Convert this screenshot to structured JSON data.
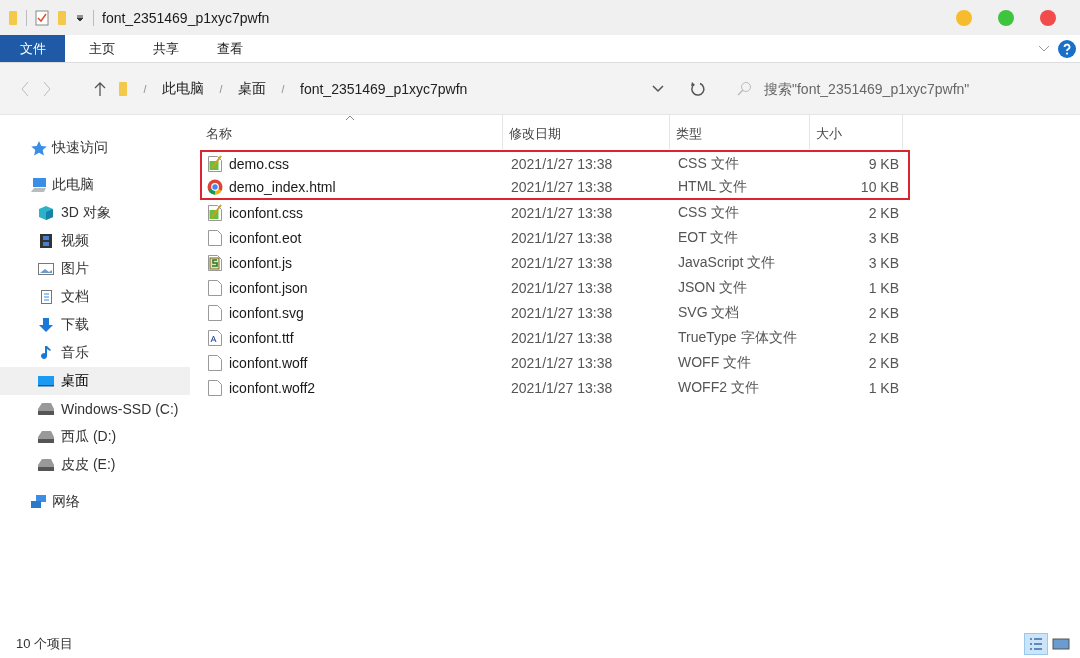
{
  "window": {
    "title": "font_2351469_p1xyc7pwfn"
  },
  "ribbon_tabs": [
    {
      "label": "文件",
      "selected": true
    },
    {
      "label": "主页",
      "selected": false
    },
    {
      "label": "共享",
      "selected": false
    },
    {
      "label": "查看",
      "selected": false
    }
  ],
  "breadcrumb": [
    "此电脑",
    "桌面",
    "font_2351469_p1xyc7pwfn"
  ],
  "search": {
    "placeholder": "搜索\"font_2351469_p1xyc7pwfn\""
  },
  "sidebar": {
    "items": [
      {
        "label": "快速访问",
        "kind": "star",
        "selected": false
      },
      {
        "label": "此电脑",
        "kind": "pc",
        "selected": false,
        "children": [
          {
            "label": "3D 对象",
            "kind": "cube",
            "selected": false
          },
          {
            "label": "视频",
            "kind": "video",
            "selected": false
          },
          {
            "label": "图片",
            "kind": "picture",
            "selected": false
          },
          {
            "label": "文档",
            "kind": "doc",
            "selected": false
          },
          {
            "label": "下载",
            "kind": "download",
            "selected": false
          },
          {
            "label": "音乐",
            "kind": "music",
            "selected": false
          },
          {
            "label": "桌面",
            "kind": "desktop",
            "selected": true
          },
          {
            "label": "Windows-SSD (C:)",
            "kind": "drive",
            "selected": false
          },
          {
            "label": "西瓜 (D:)",
            "kind": "drive",
            "selected": false
          },
          {
            "label": "皮皮 (E:)",
            "kind": "drive",
            "selected": false
          }
        ]
      },
      {
        "label": "网络",
        "kind": "network",
        "selected": false
      }
    ]
  },
  "table": {
    "columns": [
      "名称",
      "修改日期",
      "类型",
      "大小"
    ],
    "rows": [
      {
        "name": "demo.css",
        "kind": "css",
        "date": "2021/1/27 13:38",
        "type": "CSS 文件",
        "size": "9 KB",
        "highlighted": true
      },
      {
        "name": "demo_index.html",
        "kind": "html",
        "date": "2021/1/27 13:38",
        "type": "HTML 文件",
        "size": "10 KB",
        "highlighted": true
      },
      {
        "name": "iconfont.css",
        "kind": "css",
        "date": "2021/1/27 13:38",
        "type": "CSS 文件",
        "size": "2 KB",
        "highlighted": false
      },
      {
        "name": "iconfont.eot",
        "kind": "blank",
        "date": "2021/1/27 13:38",
        "type": "EOT 文件",
        "size": "3 KB",
        "highlighted": false
      },
      {
        "name": "iconfont.js",
        "kind": "js",
        "date": "2021/1/27 13:38",
        "type": "JavaScript 文件",
        "size": "3 KB",
        "highlighted": false
      },
      {
        "name": "iconfont.json",
        "kind": "blank",
        "date": "2021/1/27 13:38",
        "type": "JSON 文件",
        "size": "1 KB",
        "highlighted": false
      },
      {
        "name": "iconfont.svg",
        "kind": "blank",
        "date": "2021/1/27 13:38",
        "type": "SVG 文档",
        "size": "2 KB",
        "highlighted": false
      },
      {
        "name": "iconfont.ttf",
        "kind": "ttf",
        "date": "2021/1/27 13:38",
        "type": "TrueType 字体文件",
        "size": "2 KB",
        "highlighted": false
      },
      {
        "name": "iconfont.woff",
        "kind": "blank",
        "date": "2021/1/27 13:38",
        "type": "WOFF 文件",
        "size": "2 KB",
        "highlighted": false
      },
      {
        "name": "iconfont.woff2",
        "kind": "blank",
        "date": "2021/1/27 13:38",
        "type": "WOFF2 文件",
        "size": "1 KB",
        "highlighted": false
      }
    ]
  },
  "status_bar": {
    "count": "10 个项目"
  }
}
